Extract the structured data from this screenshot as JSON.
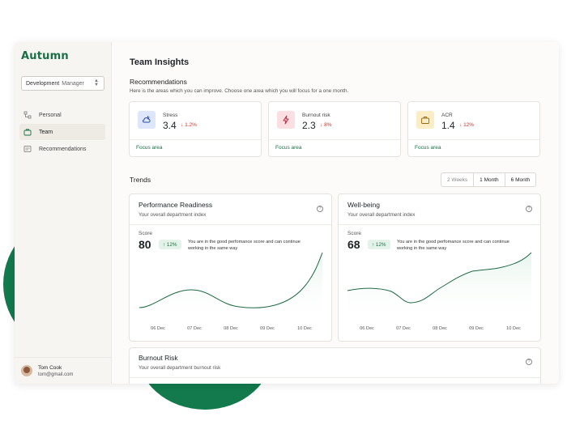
{
  "app": {
    "logo": "Autumn"
  },
  "sidebar": {
    "department": {
      "name": "Development",
      "role": "Manager"
    },
    "items": [
      {
        "label": "Personal",
        "icon": "org-chart-icon",
        "active": false
      },
      {
        "label": "Team",
        "icon": "briefcase-icon",
        "active": true
      },
      {
        "label": "Recommendations",
        "icon": "document-icon",
        "active": false
      }
    ],
    "user": {
      "name": "Tom Cook",
      "email": "tom@gmail.com"
    }
  },
  "page": {
    "title": "Team Insights"
  },
  "recommendations": {
    "title": "Recommendations",
    "subtitle": "Here is the areas which you can improve. Choose one area which you will focus for a one month.",
    "cards": [
      {
        "label": "Stress",
        "value": "3.4",
        "delta": "1.2%",
        "icon": "stress-icon",
        "icon_bg": "#dde6fb",
        "icon_color": "#2d4a9a",
        "link": "Focus area"
      },
      {
        "label": "Burnout risk",
        "value": "2.3",
        "delta": "8%",
        "icon": "lightning-icon",
        "icon_bg": "#fbdfe2",
        "icon_color": "#b3243a",
        "link": "Focus area"
      },
      {
        "label": "ACR",
        "value": "1.4",
        "delta": "12%",
        "icon": "briefcase-icon",
        "icon_bg": "#fbedc6",
        "icon_color": "#9a6a12",
        "link": "Focus area"
      }
    ]
  },
  "trends": {
    "title": "Trends",
    "ranges": [
      "2 Weeks",
      "1 Month",
      "6 Month"
    ],
    "selected_range": "2 Weeks"
  },
  "charts": [
    {
      "title": "Performance Readiness",
      "subtitle": "Your overall department index",
      "score_label": "Score",
      "score": "80",
      "delta": "12%",
      "note": "You are in the good perfomance score and can continue working in the same way",
      "x_labels": [
        "06 Dec",
        "07 Dec",
        "08 Dec",
        "09 Dec",
        "10 Dec"
      ]
    },
    {
      "title": "Well-being",
      "subtitle": "Your overall department index",
      "score_label": "Score",
      "score": "68",
      "delta": "12%",
      "note": "You are in the good perfomance score and can continue working in the same way",
      "x_labels": [
        "06 Dec",
        "07 Dec",
        "08 Dec",
        "09 Dec",
        "10 Dec"
      ]
    }
  ],
  "burnout": {
    "title": "Burnout Risk",
    "subtitle": "Your overall department burnout risk"
  },
  "colors": {
    "brand": "#1a6e45",
    "accent_blob": "#127a4c",
    "negative": "#c0392b"
  }
}
